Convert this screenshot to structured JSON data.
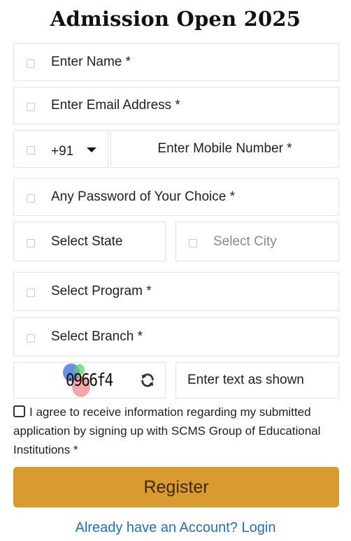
{
  "page": {
    "title": "Admission Open 2025"
  },
  "form": {
    "name_placeholder": "Enter Name *",
    "email_placeholder": "Enter Email Address *",
    "country_code": "+91",
    "mobile_placeholder": "Enter Mobile Number *",
    "password_placeholder": "Any Password of Your Choice *",
    "state_placeholder": "Select State",
    "city_placeholder": "Select City",
    "program_placeholder": "Select Program *",
    "branch_placeholder": "Select Branch *",
    "captcha_code": "0966f4",
    "captcha_input_placeholder": "Enter text as shown",
    "consent_text": "I agree to receive information regarding my submitted application by signing up with SCMS Group of Educational Institutions *",
    "consent_checked": false,
    "register_label": "Register",
    "login_link": "Already have an Account? Login"
  },
  "icons": {
    "field_icon": "square-outline-icon",
    "dropdown": "chevron-down-icon",
    "refresh": "refresh-icon"
  },
  "colors": {
    "register_button": "#d99b2f",
    "link": "#1e6fc8",
    "field_border": "#e2e2e2"
  }
}
